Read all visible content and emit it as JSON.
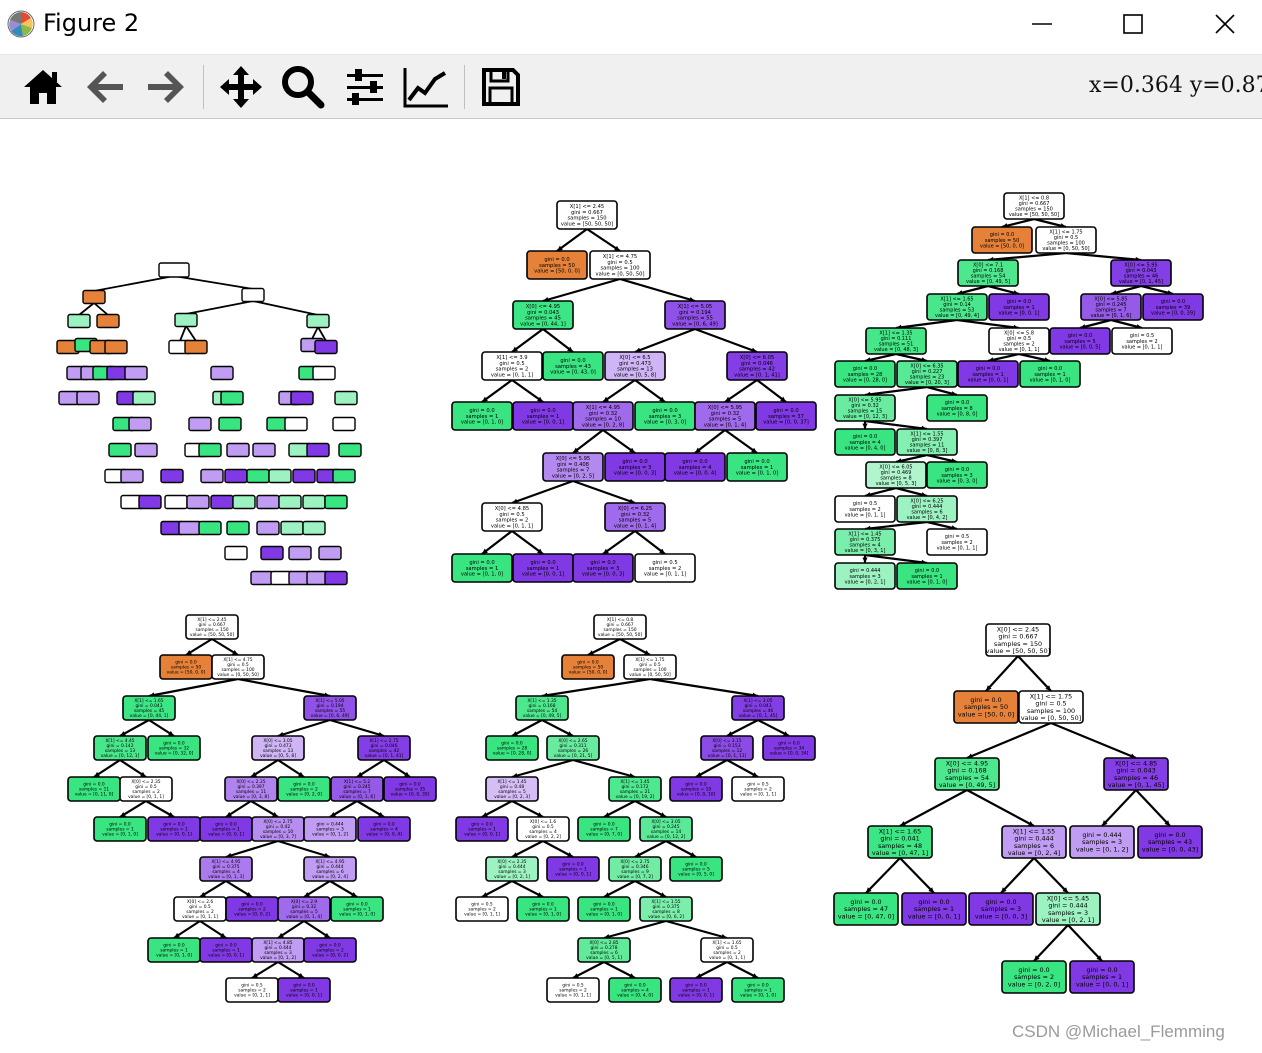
{
  "window": {
    "title": "Figure 2",
    "icons": [
      "matplotlib-logo-icon",
      "minimize-icon",
      "maximize-icon",
      "close-icon"
    ]
  },
  "toolbar": {
    "buttons": [
      "home-icon",
      "back-arrow-icon",
      "forward-arrow-icon",
      "pan-move-icon",
      "zoom-magnifier-icon",
      "configure-subplots-icon",
      "edit-axis-icon",
      "save-floppy-icon"
    ],
    "coordinates": "x=0.364  y=0.874"
  },
  "colors": {
    "setosa": "#e58139",
    "versicolor": "#39e581",
    "virginica": "#8139e5",
    "light_versicolor": "#9cf2c0",
    "light_virginica": "#c09cf2",
    "neutral": "#ffffff"
  },
  "trees": [
    {
      "nodes": {
        "0": {
          "text": "X[1] <= 2.45\ngini = 0.667\nsamples = 150\nvalue = [50, 50, 50]",
          "fill": "#ffffff"
        },
        "1": {
          "text": "gini = 0.0\nsamples = 50\nvalue = [50, 0, 0]",
          "fill": "#e58139"
        },
        "2": {
          "text": "X[1] <= 4.75\ngini = 0.5\nsamples = 100\nvalue = [0, 50, 50]",
          "fill": "#ffffff"
        },
        "3": {
          "text": "X[0] <= 4.95\ngini = 0.043\nsamples = 45\nvalue = [0, 44, 1]",
          "fill": "#3de684"
        },
        "4": {
          "text": "X[1] <= 5.05\ngini = 0.194\nsamples = 55\nvalue = [0, 6, 49]",
          "fill": "#9051e8"
        },
        "5": {
          "text": "X[1] <= 3.9\ngini = 0.5\nsamples = 2\nvalue = [0, 1, 1]",
          "fill": "#ffffff"
        },
        "6": {
          "text": "gini = 0.0\nsamples = 43\nvalue = [0, 43, 0]",
          "fill": "#39e581"
        },
        "7": {
          "text": "X[0] <= 6.5\ngini = 0.473\nsamples = 13\nvalue = [0, 5, 8]",
          "fill": "#cfb5f5"
        },
        "8": {
          "text": "X[0] <= 6.05\ngini = 0.046\nsamples = 42\nvalue = [0, 1, 41]",
          "fill": "#843ee6"
        },
        "9": {
          "text": "gini = 0.0\nsamples = 1\nvalue = [0, 1, 0]",
          "fill": "#39e581"
        },
        "10": {
          "text": "gini = 0.0\nsamples = 1\nvalue = [0, 0, 1]",
          "fill": "#8139e5"
        },
        "11": {
          "text": "X[1] <= 4.95\ngini = 0.32\nsamples = 10\nvalue = [0, 2, 8]",
          "fill": "#a06aec"
        },
        "12": {
          "text": "gini = 0.0\nsamples = 3\nvalue = [0, 3, 0]",
          "fill": "#39e581"
        },
        "13": {
          "text": "X[0] <= 5.95\ngini = 0.32\nsamples = 5\nvalue = [0, 1, 4]",
          "fill": "#a06aec"
        },
        "14": {
          "text": "gini = 0.0\nsamples = 37\nvalue = [0, 0, 37]",
          "fill": "#8139e5"
        },
        "15": {
          "text": "X[0] <= 5.95\ngini = 0.408\nsamples = 7\nvalue = [0, 2, 5]",
          "fill": "#b388ef"
        },
        "16": {
          "text": "gini = 0.0\nsamples = 3\nvalue = [0, 0, 3]",
          "fill": "#8139e5"
        },
        "17": {
          "text": "gini = 0.0\nsamples = 4\nvalue = [0, 0, 4]",
          "fill": "#8139e5"
        },
        "18": {
          "text": "gini = 0.0\nsamples = 1\nvalue = [0, 1, 0]",
          "fill": "#39e581"
        },
        "19": {
          "text": "X[0] <= 4.85\ngini = 0.5\nsamples = 2\nvalue = [0, 1, 1]",
          "fill": "#ffffff"
        },
        "20": {
          "text": "X[0] <= 6.25\ngini = 0.32\nsamples = 5\nvalue = [0, 1, 4]",
          "fill": "#a06aec"
        },
        "21": {
          "text": "gini = 0.0\nsamples = 1\nvalue = [0, 1, 0]",
          "fill": "#39e581"
        },
        "22": {
          "text": "gini = 0.0\nsamples = 1\nvalue = [0, 0, 1]",
          "fill": "#8139e5"
        },
        "23": {
          "text": "gini = 0.0\nsamples = 3\nvalue = [0, 0, 3]",
          "fill": "#8139e5"
        },
        "24": {
          "text": "gini = 0.5\nsamples = 2\nvalue = [0, 1, 1]",
          "fill": "#ffffff"
        }
      }
    },
    {
      "nodes": {
        "0": {
          "text": "X[1] <= 0.8\ngini = 0.667\nsamples = 150\nvalue = [50, 50, 50]",
          "fill": "#ffffff"
        },
        "1": {
          "text": "gini = 0.0\nsamples = 50\nvalue = [50, 0, 0]",
          "fill": "#e58139"
        },
        "2": {
          "text": "X[1] <= 1.75\ngini = 0.5\nsamples = 100\nvalue = [0, 50, 50]",
          "fill": "#ffffff"
        },
        "3": {
          "text": "X[0] <= 7.1\ngini = 0.168\nsamples = 54\nvalue = [0, 49, 5]",
          "fill": "#4de88e"
        },
        "4": {
          "text": "X[0] <= 5.95\ngini = 0.043\nsamples = 46\nvalue = [0, 1, 45]",
          "fill": "#843ee6"
        },
        "5": {
          "text": "X[1] <= 1.65\ngini = 0.14\nsamples = 53\nvalue = [0, 49, 4]",
          "fill": "#49e78b"
        },
        "6": {
          "text": "gini = 0.0\nsamples = 1\nvalue = [0, 0, 1]",
          "fill": "#8139e5"
        },
        "7": {
          "text": "X[0] <= 5.85\ngini = 0.245\nsamples = 7\nvalue = [0, 1, 6]",
          "fill": "#965ae9"
        },
        "8": {
          "text": "gini = 0.0\nsamples = 39\nvalue = [0, 0, 39]",
          "fill": "#8139e5"
        },
        "9": {
          "text": "X[1] <= 1.35\ngini = 0.111\nsamples = 51\nvalue = [0, 48, 3]",
          "fill": "#45e789"
        },
        "10": {
          "text": "X[0] <= 5.8\ngini = 0.5\nsamples = 2\nvalue = [0, 1, 1]",
          "fill": "#ffffff"
        },
        "11": {
          "text": "gini = 0.0\nsamples = 5\nvalue = [0, 0, 5]",
          "fill": "#8139e5"
        },
        "12": {
          "text": "gini = 0.5\nsamples = 2\nvalue = [0, 1, 1]",
          "fill": "#ffffff"
        },
        "13": {
          "text": "gini = 0.0\nsamples = 28\nvalue = [0, 28, 0]",
          "fill": "#39e581"
        },
        "14": {
          "text": "X[0] <= 6.35\ngini = 0.227\nsamples = 23\nvalue = [0, 20, 3]",
          "fill": "#57e995"
        },
        "15": {
          "text": "gini = 0.0\nsamples = 1\nvalue = [0, 0, 1]",
          "fill": "#8139e5"
        },
        "16": {
          "text": "gini = 0.0\nsamples = 1\nvalue = [0, 1, 0]",
          "fill": "#39e581"
        },
        "17": {
          "text": "X[0] <= 5.95\ngini = 0.32\nsamples = 15\nvalue = [0, 12, 3]",
          "fill": "#6aeca0"
        },
        "18": {
          "text": "gini = 0.0\nsamples = 8\nvalue = [0, 8, 0]",
          "fill": "#39e581"
        },
        "19": {
          "text": "gini = 0.0\nsamples = 4\nvalue = [0, 4, 0]",
          "fill": "#39e581"
        },
        "20": {
          "text": "X[1] <= 1.55\ngini = 0.397\nsamples = 11\nvalue = [0, 8, 3]",
          "fill": "#83efb0"
        },
        "21": {
          "text": "X[0] <= 6.05\ngini = 0.469\nsamples = 8\nvalue = [0, 5, 3]",
          "fill": "#b0f5cd"
        },
        "22": {
          "text": "gini = 0.0\nsamples = 3\nvalue = [0, 3, 0]",
          "fill": "#39e581"
        },
        "23": {
          "text": "gini = 0.5\nsamples = 2\nvalue = [0, 1, 1]",
          "fill": "#ffffff"
        },
        "24": {
          "text": "X[0] <= 6.25\ngini = 0.444\nsamples = 6\nvalue = [0, 4, 2]",
          "fill": "#9cf2c0"
        },
        "25": {
          "text": "X[1] <= 1.45\ngini = 0.375\nsamples = 4\nvalue = [0, 3, 1]",
          "fill": "#7beeab"
        },
        "26": {
          "text": "gini = 0.5\nsamples = 2\nvalue = [0, 1, 1]",
          "fill": "#ffffff"
        },
        "27": {
          "text": "gini = 0.444\nsamples = 3\nvalue = [0, 2, 1]",
          "fill": "#9cf2c0"
        },
        "28": {
          "text": "gini = 0.0\nsamples = 1\nvalue = [0, 1, 0]",
          "fill": "#39e581"
        }
      }
    },
    {
      "nodes": {
        "0": {
          "text": "X[1] <= 2.45\ngini = 0.667\nsamples = 150\nvalue = [50, 50, 50]",
          "fill": "#ffffff"
        },
        "1": {
          "text": "gini = 0.0\nsamples = 50\nvalue = [50, 0, 0]",
          "fill": "#e58139"
        },
        "2": {
          "text": "X[1] <= 4.75\ngini = 0.5\nsamples = 100\nvalue = [0, 50, 50]",
          "fill": "#ffffff"
        },
        "3": {
          "text": "X[1] <= 1.65\ngini = 0.043\nsamples = 45\nvalue = [0, 44, 1]",
          "fill": "#3de684"
        },
        "4": {
          "text": "X[1] <= 5.05\ngini = 0.194\nsamples = 55\nvalue = [0, 6, 49]",
          "fill": "#9051e8"
        },
        "5": {
          "text": "X[1] <= 4.45\ngini = 0.142\nsamples = 13\nvalue = [0, 12, 1]",
          "fill": "#49e78b"
        },
        "6": {
          "text": "gini = 0.0\nsamples = 32\nvalue = [0, 32, 0]",
          "fill": "#39e581"
        },
        "7": {
          "text": "X[0] <= 3.05\ngini = 0.473\nsamples = 13\nvalue = [0, 5, 8]",
          "fill": "#cfb5f5"
        },
        "8": {
          "text": "X[1] <= 2.75\ngini = 0.046\nsamples = 42\nvalue = [0, 1, 41]",
          "fill": "#843ee6"
        },
        "9": {
          "text": "gini = 0.0\nsamples = 11\nvalue = [0, 11, 0]",
          "fill": "#39e581"
        },
        "10": {
          "text": "X[0] <= 2.35\ngini = 0.5\nsamples = 2\nvalue = [0, 1, 1]",
          "fill": "#ffffff"
        },
        "11": {
          "text": "X[0] <= 2.25\ngini = 0.397\nsamples = 11\nvalue = [0, 3, 8]",
          "fill": "#b083ef"
        },
        "12": {
          "text": "gini = 0.0\nsamples = 2\nvalue = [0, 2, 0]",
          "fill": "#39e581"
        },
        "13": {
          "text": "X[1] <= 5.2\ngini = 0.245\nsamples = 7\nvalue = [0, 1, 6]",
          "fill": "#965ae9"
        },
        "14": {
          "text": "gini = 0.0\nsamples = 35\nvalue = [0, 0, 35]",
          "fill": "#8139e5"
        },
        "15": {
          "text": "gini = 0.0\nsamples = 1\nvalue = [0, 1, 0]",
          "fill": "#39e581"
        },
        "16": {
          "text": "gini = 0.0\nsamples = 1\nvalue = [0, 0, 1]",
          "fill": "#8139e5"
        },
        "17": {
          "text": "gini = 0.0\nsamples = 1\nvalue = [0, 0, 1]",
          "fill": "#8139e5"
        },
        "18": {
          "text": "X[0] <= 2.75\ngini = 0.42\nsamples = 10\nvalue = [0, 3, 7]",
          "fill": "#b78ef0"
        },
        "19": {
          "text": "gini = 0.444\nsamples = 3\nvalue = [0, 1, 2]",
          "fill": "#c09cf2"
        },
        "20": {
          "text": "gini = 0.0\nsamples = 4\nvalue = [0, 0, 4]",
          "fill": "#8139e5"
        },
        "21": {
          "text": "X[1] <= 4.95\ngini = 0.375\nsamples = 4\nvalue = [0, 1, 3]",
          "fill": "#ab7bee"
        },
        "22": {
          "text": "X[1] <= 4.95\ngini = 0.444\nsamples = 6\nvalue = [0, 2, 4]",
          "fill": "#c09cf2"
        },
        "23": {
          "text": "X[0] <= 2.6\ngini = 0.5\nsamples = 2\nvalue = [0, 1, 1]",
          "fill": "#ffffff"
        },
        "24": {
          "text": "gini = 0.0\nsamples = 2\nvalue = [0, 0, 2]",
          "fill": "#8139e5"
        },
        "25": {
          "text": "X[0] <= 2.9\ngini = 0.32\nsamples = 5\nvalue = [0, 1, 4]",
          "fill": "#a06aec"
        },
        "26": {
          "text": "gini = 0.0\nsamples = 1\nvalue = [0, 1, 0]",
          "fill": "#39e581"
        },
        "27": {
          "text": "gini = 0.0\nsamples = 1\nvalue = [0, 1, 0]",
          "fill": "#39e581"
        },
        "28": {
          "text": "gini = 0.0\nsamples = 1\nvalue = [0, 0, 1]",
          "fill": "#8139e5"
        },
        "29": {
          "text": "X[1] <= 4.85\ngini = 0.444\nsamples = 3\nvalue = [0, 1, 2]",
          "fill": "#c09cf2"
        },
        "30": {
          "text": "gini = 0.0\nsamples = 2\nvalue = [0, 0, 2]",
          "fill": "#8139e5"
        },
        "31": {
          "text": "gini = 0.5\nsamples = 2\nvalue = [0, 1, 1]",
          "fill": "#ffffff"
        },
        "32": {
          "text": "gini = 0.0\nsamples = 1\nvalue = [0, 0, 1]",
          "fill": "#8139e5"
        }
      }
    },
    {
      "nodes": {
        "0": {
          "text": "X[1] <= 0.8\ngini = 0.667\nsamples = 150\nvalue = [50, 50, 50]",
          "fill": "#ffffff"
        },
        "1": {
          "text": "gini = 0.0\nsamples = 50\nvalue = [50, 0, 0]",
          "fill": "#e58139"
        },
        "2": {
          "text": "X[1] <= 1.75\ngini = 0.5\nsamples = 100\nvalue = [0, 50, 50]",
          "fill": "#ffffff"
        },
        "3": {
          "text": "X[1] <= 1.35\ngini = 0.168\nsamples = 54\nvalue = [0, 49, 5]",
          "fill": "#4de88e"
        },
        "4": {
          "text": "X[1] <= 3.05\ngini = 0.043\nsamples = 46\nvalue = [0, 1, 45]",
          "fill": "#843ee6"
        },
        "5": {
          "text": "gini = 0.0\nsamples = 28\nvalue = [0, 28, 0]",
          "fill": "#39e581"
        },
        "6": {
          "text": "X[0] <= 2.65\ngini = 0.311\nsamples = 26\nvalue = [0, 21, 5]",
          "fill": "#68eb9f"
        },
        "7": {
          "text": "X[0] <= 3.15\ngini = 0.153\nsamples = 12\nvalue = [0, 1, 11]",
          "fill": "#8c4be7"
        },
        "8": {
          "text": "gini = 0.0\nsamples = 34\nvalue = [0, 0, 34]",
          "fill": "#8139e5"
        },
        "9": {
          "text": "X[1] <= 1.45\ngini = 0.48\nsamples = 5\nvalue = [0, 2, 3]",
          "fill": "#d5bdf6"
        },
        "10": {
          "text": "X[1] <= 1.45\ngini = 0.172\nsamples = 21\nvalue = [0, 19, 2]",
          "fill": "#4ee88e"
        },
        "11": {
          "text": "gini = 0.0\nsamples = 10\nvalue = [0, 0, 10]",
          "fill": "#8139e5"
        },
        "12": {
          "text": "gini = 0.5\nsamples = 2\nvalue = [0, 1, 1]",
          "fill": "#ffffff"
        },
        "13": {
          "text": "gini = 0.0\nsamples = 1\nvalue = [0, 0, 1]",
          "fill": "#8139e5"
        },
        "14": {
          "text": "X[0] <= 1.6\ngini = 0.5\nsamples = 4\nvalue = [0, 2, 2]",
          "fill": "#ffffff"
        },
        "15": {
          "text": "gini = 0.0\nsamples = 7\nvalue = [0, 7, 0]",
          "fill": "#39e581"
        },
        "16": {
          "text": "X[0] <= 3.05\ngini = 0.245\nsamples = 14\nvalue = [0, 12, 2]",
          "fill": "#5ae996"
        },
        "17": {
          "text": "X[0] <= 2.35\ngini = 0.444\nsamples = 3\nvalue = [0, 2, 1]",
          "fill": "#9cf2c0"
        },
        "18": {
          "text": "gini = 0.0\nsamples = 1\nvalue = [0, 0, 1]",
          "fill": "#8139e5"
        },
        "19": {
          "text": "X[0] <= 2.75\ngini = 0.346\nsamples = 9\nvalue = [0, 7, 2]",
          "fill": "#72eca5"
        },
        "20": {
          "text": "gini = 0.0\nsamples = 5\nvalue = [0, 5, 0]",
          "fill": "#39e581"
        },
        "21": {
          "text": "gini = 0.5\nsamples = 2\nvalue = [0, 1, 1]",
          "fill": "#ffffff"
        },
        "22": {
          "text": "gini = 0.0\nsamples = 1\nvalue = [0, 1, 0]",
          "fill": "#39e581"
        },
        "23": {
          "text": "gini = 0.0\nsamples = 1\nvalue = [0, 1, 0]",
          "fill": "#39e581"
        },
        "24": {
          "text": "X[1] <= 1.55\ngini = 0.375\nsamples = 8\nvalue = [0, 6, 2]",
          "fill": "#7beeab"
        },
        "25": {
          "text": "X[0] <= 2.85\ngini = 0.278\nsamples = 6\nvalue = [0, 5, 1]",
          "fill": "#61ea9a"
        },
        "26": {
          "text": "X[1] <= 1.65\ngini = 0.5\nsamples = 2\nvalue = [0, 1, 1]",
          "fill": "#ffffff"
        },
        "27": {
          "text": "gini = 0.5\nsamples = 2\nvalue = [0, 1, 1]",
          "fill": "#ffffff"
        },
        "28": {
          "text": "gini = 0.0\nsamples = 4\nvalue = [0, 4, 0]",
          "fill": "#39e581"
        },
        "29": {
          "text": "gini = 0.0\nsamples = 1\nvalue = [0, 0, 1]",
          "fill": "#8139e5"
        },
        "30": {
          "text": "gini = 0.0\nsamples = 1\nvalue = [0, 1, 0]",
          "fill": "#39e581"
        }
      }
    },
    {
      "nodes": {
        "0": {
          "text": "X[0] <= 2.45\ngini = 0.667\nsamples = 150\nvalue = [50, 50, 50]",
          "fill": "#ffffff"
        },
        "1": {
          "text": "gini = 0.0\nsamples = 50\nvalue = [50, 0, 0]",
          "fill": "#e58139"
        },
        "2": {
          "text": "X[1] <= 1.75\ngini = 0.5\nsamples = 100\nvalue = [0, 50, 50]",
          "fill": "#ffffff"
        },
        "3": {
          "text": "X[0] <= 4.95\ngini = 0.168\nsamples = 54\nvalue = [0, 49, 5]",
          "fill": "#4de88e"
        },
        "4": {
          "text": "X[0] <= 4.85\ngini = 0.043\nsamples = 46\nvalue = [0, 1, 45]",
          "fill": "#843ee6"
        },
        "5": {
          "text": "X[1] <= 1.65\ngini = 0.041\nsamples = 48\nvalue = [0, 47, 1]",
          "fill": "#3de684"
        },
        "6": {
          "text": "X[1] <= 1.55\ngini = 0.444\nsamples = 6\nvalue = [0, 2, 4]",
          "fill": "#c09cf2"
        },
        "7": {
          "text": "gini = 0.444\nsamples = 3\nvalue = [0, 1, 2]",
          "fill": "#c09cf2"
        },
        "8": {
          "text": "gini = 0.0\nsamples = 43\nvalue = [0, 0, 43]",
          "fill": "#8139e5"
        },
        "9": {
          "text": "gini = 0.0\nsamples = 47\nvalue = [0, 47, 0]",
          "fill": "#39e581"
        },
        "10": {
          "text": "gini = 0.0\nsamples = 1\nvalue = [0, 0, 1]",
          "fill": "#8139e5"
        },
        "11": {
          "text": "gini = 0.0\nsamples = 3\nvalue = [0, 0, 3]",
          "fill": "#8139e5"
        },
        "12": {
          "text": "X[0] <= 5.45\ngini = 0.444\nsamples = 3\nvalue = [0, 2, 1]",
          "fill": "#9cf2c0"
        },
        "13": {
          "text": "gini = 0.0\nsamples = 2\nvalue = [0, 2, 0]",
          "fill": "#39e581"
        },
        "14": {
          "text": "gini = 0.0\nsamples = 1\nvalue = [0, 0, 1]",
          "fill": "#8139e5"
        }
      }
    }
  ],
  "watermark": "CSDN @Michael_Flemming"
}
